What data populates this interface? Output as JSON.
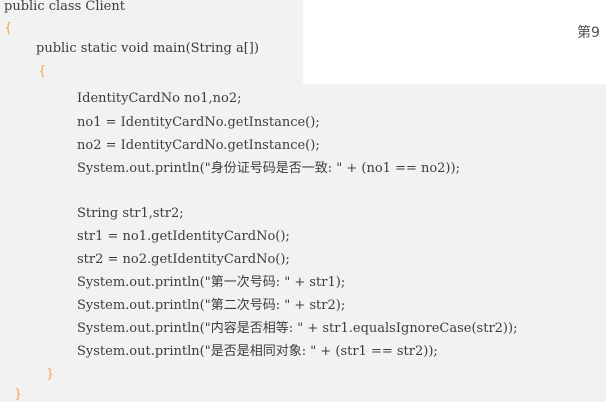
{
  "page_label": "第9",
  "code": {
    "line_01": "public class Client",
    "line_02": "{",
    "line_03": "public static void main(String a[])",
    "line_04": "{",
    "line_05": "IdentityCardNo no1,no2;",
    "line_06": "no1 = IdentityCardNo.getInstance();",
    "line_07": "no2 = IdentityCardNo.getInstance();",
    "line_08": "System.out.println(\"身份证号码是否一致: \" + (no1 == no2));",
    "line_09": "String str1,str2;",
    "line_10": "str1 = no1.getIdentityCardNo();",
    "line_11": "str2 = no2.getIdentityCardNo();",
    "line_12": "System.out.println(\"第一次号码: \" + str1);",
    "line_13": "System.out.println(\"第二次号码: \" + str2);",
    "line_14": "System.out.println(\"内容是否相等: \" + str1.equalsIgnoreCase(str2));",
    "line_15": "System.out.println(\"是否是相同对象: \" + (str1 == str2));",
    "line_16": "}",
    "line_17": "}"
  },
  "colors": {
    "background": "#f2f2f2",
    "code_text": "#3c3c3c",
    "brace": "#f0a24c"
  }
}
